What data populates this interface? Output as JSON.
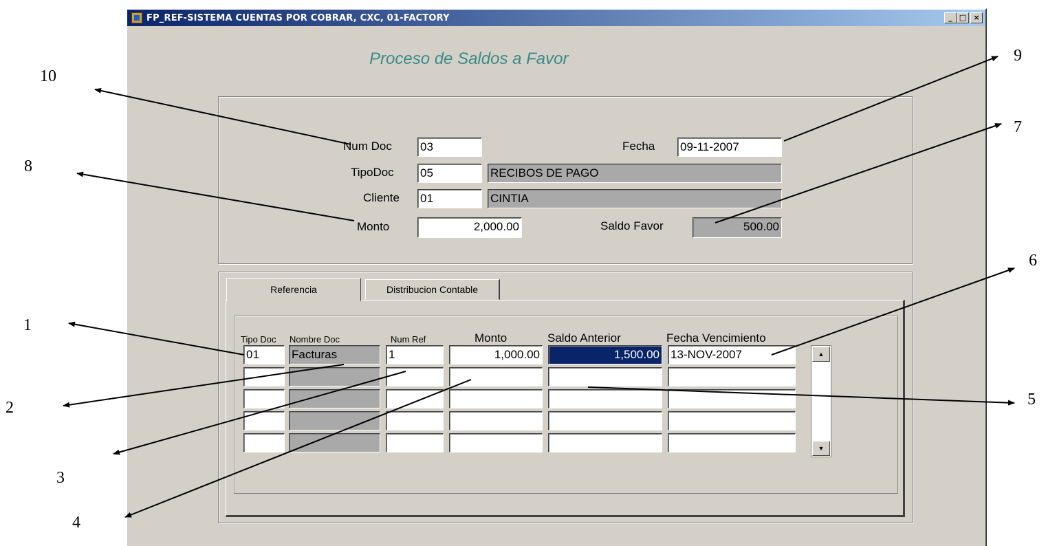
{
  "window": {
    "title": "FP_REF-SISTEMA CUENTAS POR COBRAR, CXC, 01-FACTORY",
    "buttons": {
      "minimize": "_",
      "maximize": "□",
      "close": "×"
    }
  },
  "form_title": "Proceso de Saldos a Favor",
  "header": {
    "num_doc": {
      "label": "Num Doc",
      "value": "03"
    },
    "fecha": {
      "label": "Fecha",
      "value": "09-11-2007"
    },
    "tipo_doc": {
      "label": "TipoDoc",
      "value": "05",
      "desc": "RECIBOS DE PAGO"
    },
    "cliente": {
      "label": "Cliente",
      "value": "01",
      "desc": "CINTIA"
    },
    "monto": {
      "label": "Monto",
      "value": "2,000.00"
    },
    "saldo_favor": {
      "label": "Saldo Favor",
      "value": "500.00"
    }
  },
  "tabs": [
    {
      "label": "Referencia",
      "active": true
    },
    {
      "label": "Distribucion Contable",
      "active": false
    }
  ],
  "grid": {
    "columns": [
      "Tipo Doc",
      "Nombre Doc",
      "Num Ref",
      "Monto",
      "Saldo Anterior",
      "Fecha Vencimiento"
    ],
    "rows": [
      [
        "01",
        "Facturas",
        "1",
        "1,000.00",
        "1,500.00",
        "13-NOV-2007"
      ],
      [
        "",
        "",
        "",
        "",
        "",
        ""
      ],
      [
        "",
        "",
        "",
        "",
        "",
        ""
      ],
      [
        "",
        "",
        "",
        "",
        "",
        ""
      ],
      [
        "",
        "",
        "",
        "",
        "",
        ""
      ]
    ]
  },
  "annotations": [
    "1",
    "2",
    "3",
    "4",
    "5",
    "6",
    "7",
    "8",
    "9",
    "10"
  ],
  "colors": {
    "title_start": "#0a246a",
    "title_end": "#a6caf0",
    "form_title": "#3a8a8a",
    "readonly": "#a9a9a9",
    "selection": "#0a246a"
  }
}
